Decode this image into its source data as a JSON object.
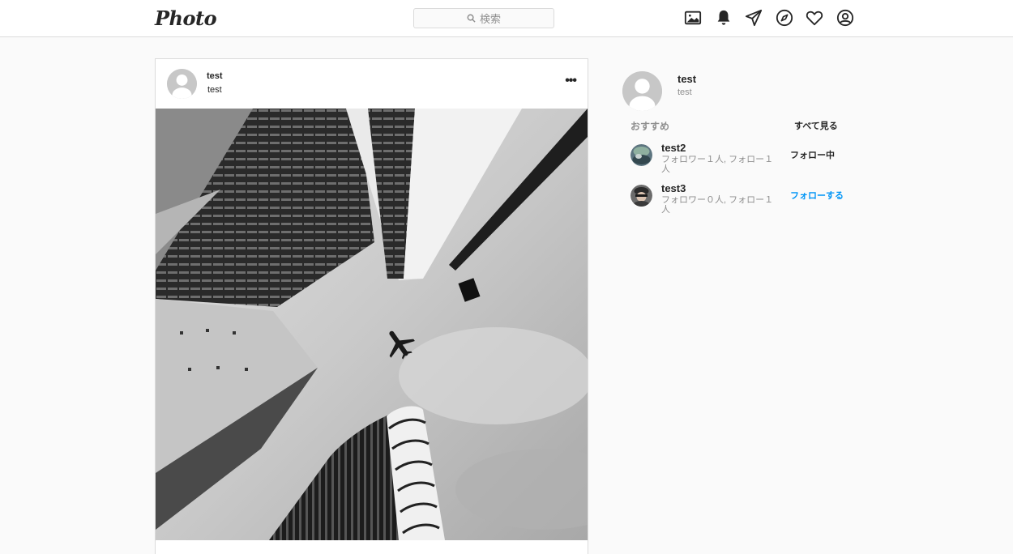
{
  "header": {
    "logo": "Photo",
    "search_placeholder": "検索",
    "nav_icons": [
      "image-icon",
      "bell-icon",
      "send-icon",
      "compass-icon",
      "heart-icon",
      "profile-icon"
    ]
  },
  "post": {
    "username": "test",
    "location": "test",
    "more": "•••"
  },
  "sidebar": {
    "me": {
      "username": "test",
      "name": "test"
    },
    "recommend_title": "おすすめ",
    "see_all": "すべて見る",
    "suggestions": [
      {
        "username": "test2",
        "stats": "フォロワー１人, フォロー１人",
        "action": "フォロー中"
      },
      {
        "username": "test3",
        "stats": "フォロワー０人, フォロー１人",
        "action": "フォローする"
      }
    ]
  },
  "colors": {
    "accent": "#0095f6",
    "border": "#dbdbdb",
    "muted": "#8e8e8e"
  }
}
